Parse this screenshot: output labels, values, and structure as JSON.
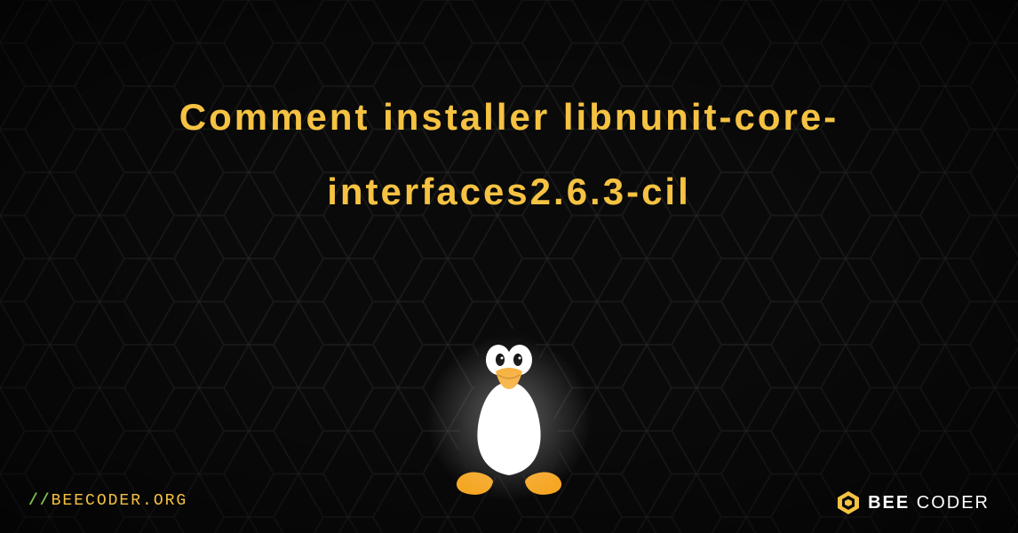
{
  "title": "Comment installer libnunit-core-interfaces2.6.3-cil",
  "footer": {
    "url_prefix": "//",
    "url_text": "BEECODER.ORG",
    "brand_bold": "BEE",
    "brand_light": "CODER"
  },
  "colors": {
    "accent": "#f5c242",
    "bg": "#0a0a0a",
    "slash": "#7fbf4f"
  }
}
